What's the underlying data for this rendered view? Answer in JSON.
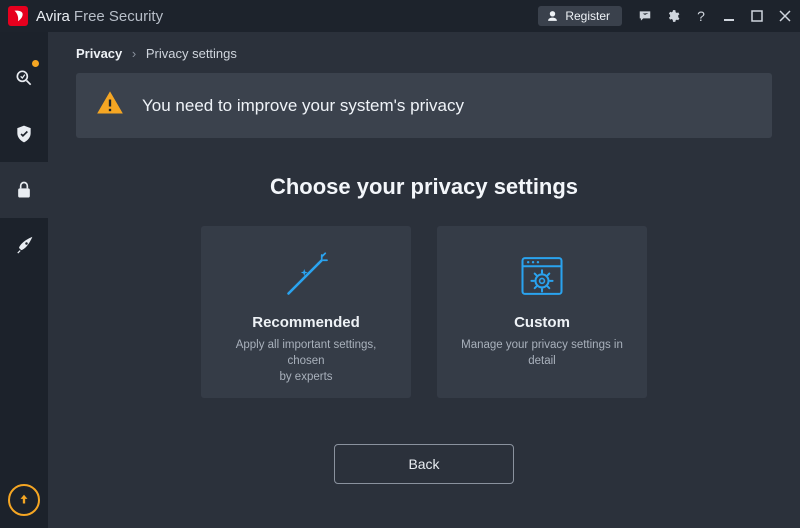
{
  "titlebar": {
    "brand": "Avira",
    "brandSub": "Free Security",
    "registerLabel": "Register"
  },
  "breadcrumb": {
    "root": "Privacy",
    "current": "Privacy settings"
  },
  "alert": {
    "message": "You need to improve your system's privacy"
  },
  "section": {
    "title": "Choose your privacy settings"
  },
  "cards": {
    "recommended": {
      "title": "Recommended",
      "sub": "Apply all important settings, chosen\nby experts"
    },
    "custom": {
      "title": "Custom",
      "sub": "Manage your privacy settings in\ndetail"
    }
  },
  "buttons": {
    "back": "Back"
  }
}
